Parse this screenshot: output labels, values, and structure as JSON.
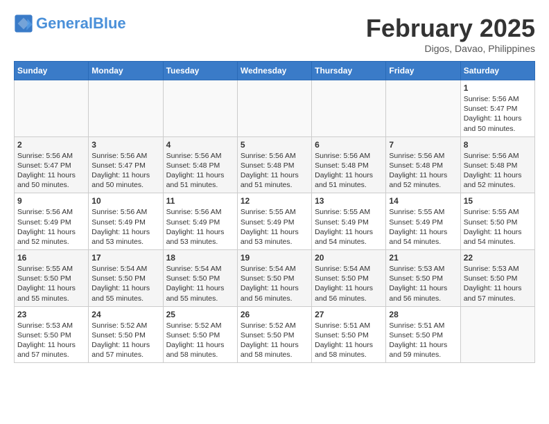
{
  "header": {
    "logo_general": "General",
    "logo_blue": "Blue",
    "title": "February 2025",
    "location": "Digos, Davao, Philippines"
  },
  "days_of_week": [
    "Sunday",
    "Monday",
    "Tuesday",
    "Wednesday",
    "Thursday",
    "Friday",
    "Saturday"
  ],
  "weeks": [
    [
      {
        "day": "",
        "info": ""
      },
      {
        "day": "",
        "info": ""
      },
      {
        "day": "",
        "info": ""
      },
      {
        "day": "",
        "info": ""
      },
      {
        "day": "",
        "info": ""
      },
      {
        "day": "",
        "info": ""
      },
      {
        "day": "1",
        "info": "Sunrise: 5:56 AM\nSunset: 5:47 PM\nDaylight: 11 hours\nand 50 minutes."
      }
    ],
    [
      {
        "day": "2",
        "info": "Sunrise: 5:56 AM\nSunset: 5:47 PM\nDaylight: 11 hours\nand 50 minutes."
      },
      {
        "day": "3",
        "info": "Sunrise: 5:56 AM\nSunset: 5:47 PM\nDaylight: 11 hours\nand 50 minutes."
      },
      {
        "day": "4",
        "info": "Sunrise: 5:56 AM\nSunset: 5:48 PM\nDaylight: 11 hours\nand 51 minutes."
      },
      {
        "day": "5",
        "info": "Sunrise: 5:56 AM\nSunset: 5:48 PM\nDaylight: 11 hours\nand 51 minutes."
      },
      {
        "day": "6",
        "info": "Sunrise: 5:56 AM\nSunset: 5:48 PM\nDaylight: 11 hours\nand 51 minutes."
      },
      {
        "day": "7",
        "info": "Sunrise: 5:56 AM\nSunset: 5:48 PM\nDaylight: 11 hours\nand 52 minutes."
      },
      {
        "day": "8",
        "info": "Sunrise: 5:56 AM\nSunset: 5:48 PM\nDaylight: 11 hours\nand 52 minutes."
      }
    ],
    [
      {
        "day": "9",
        "info": "Sunrise: 5:56 AM\nSunset: 5:49 PM\nDaylight: 11 hours\nand 52 minutes."
      },
      {
        "day": "10",
        "info": "Sunrise: 5:56 AM\nSunset: 5:49 PM\nDaylight: 11 hours\nand 53 minutes."
      },
      {
        "day": "11",
        "info": "Sunrise: 5:56 AM\nSunset: 5:49 PM\nDaylight: 11 hours\nand 53 minutes."
      },
      {
        "day": "12",
        "info": "Sunrise: 5:55 AM\nSunset: 5:49 PM\nDaylight: 11 hours\nand 53 minutes."
      },
      {
        "day": "13",
        "info": "Sunrise: 5:55 AM\nSunset: 5:49 PM\nDaylight: 11 hours\nand 54 minutes."
      },
      {
        "day": "14",
        "info": "Sunrise: 5:55 AM\nSunset: 5:49 PM\nDaylight: 11 hours\nand 54 minutes."
      },
      {
        "day": "15",
        "info": "Sunrise: 5:55 AM\nSunset: 5:50 PM\nDaylight: 11 hours\nand 54 minutes."
      }
    ],
    [
      {
        "day": "16",
        "info": "Sunrise: 5:55 AM\nSunset: 5:50 PM\nDaylight: 11 hours\nand 55 minutes."
      },
      {
        "day": "17",
        "info": "Sunrise: 5:54 AM\nSunset: 5:50 PM\nDaylight: 11 hours\nand 55 minutes."
      },
      {
        "day": "18",
        "info": "Sunrise: 5:54 AM\nSunset: 5:50 PM\nDaylight: 11 hours\nand 55 minutes."
      },
      {
        "day": "19",
        "info": "Sunrise: 5:54 AM\nSunset: 5:50 PM\nDaylight: 11 hours\nand 56 minutes."
      },
      {
        "day": "20",
        "info": "Sunrise: 5:54 AM\nSunset: 5:50 PM\nDaylight: 11 hours\nand 56 minutes."
      },
      {
        "day": "21",
        "info": "Sunrise: 5:53 AM\nSunset: 5:50 PM\nDaylight: 11 hours\nand 56 minutes."
      },
      {
        "day": "22",
        "info": "Sunrise: 5:53 AM\nSunset: 5:50 PM\nDaylight: 11 hours\nand 57 minutes."
      }
    ],
    [
      {
        "day": "23",
        "info": "Sunrise: 5:53 AM\nSunset: 5:50 PM\nDaylight: 11 hours\nand 57 minutes."
      },
      {
        "day": "24",
        "info": "Sunrise: 5:52 AM\nSunset: 5:50 PM\nDaylight: 11 hours\nand 57 minutes."
      },
      {
        "day": "25",
        "info": "Sunrise: 5:52 AM\nSunset: 5:50 PM\nDaylight: 11 hours\nand 58 minutes."
      },
      {
        "day": "26",
        "info": "Sunrise: 5:52 AM\nSunset: 5:50 PM\nDaylight: 11 hours\nand 58 minutes."
      },
      {
        "day": "27",
        "info": "Sunrise: 5:51 AM\nSunset: 5:50 PM\nDaylight: 11 hours\nand 58 minutes."
      },
      {
        "day": "28",
        "info": "Sunrise: 5:51 AM\nSunset: 5:50 PM\nDaylight: 11 hours\nand 59 minutes."
      },
      {
        "day": "",
        "info": ""
      }
    ]
  ]
}
